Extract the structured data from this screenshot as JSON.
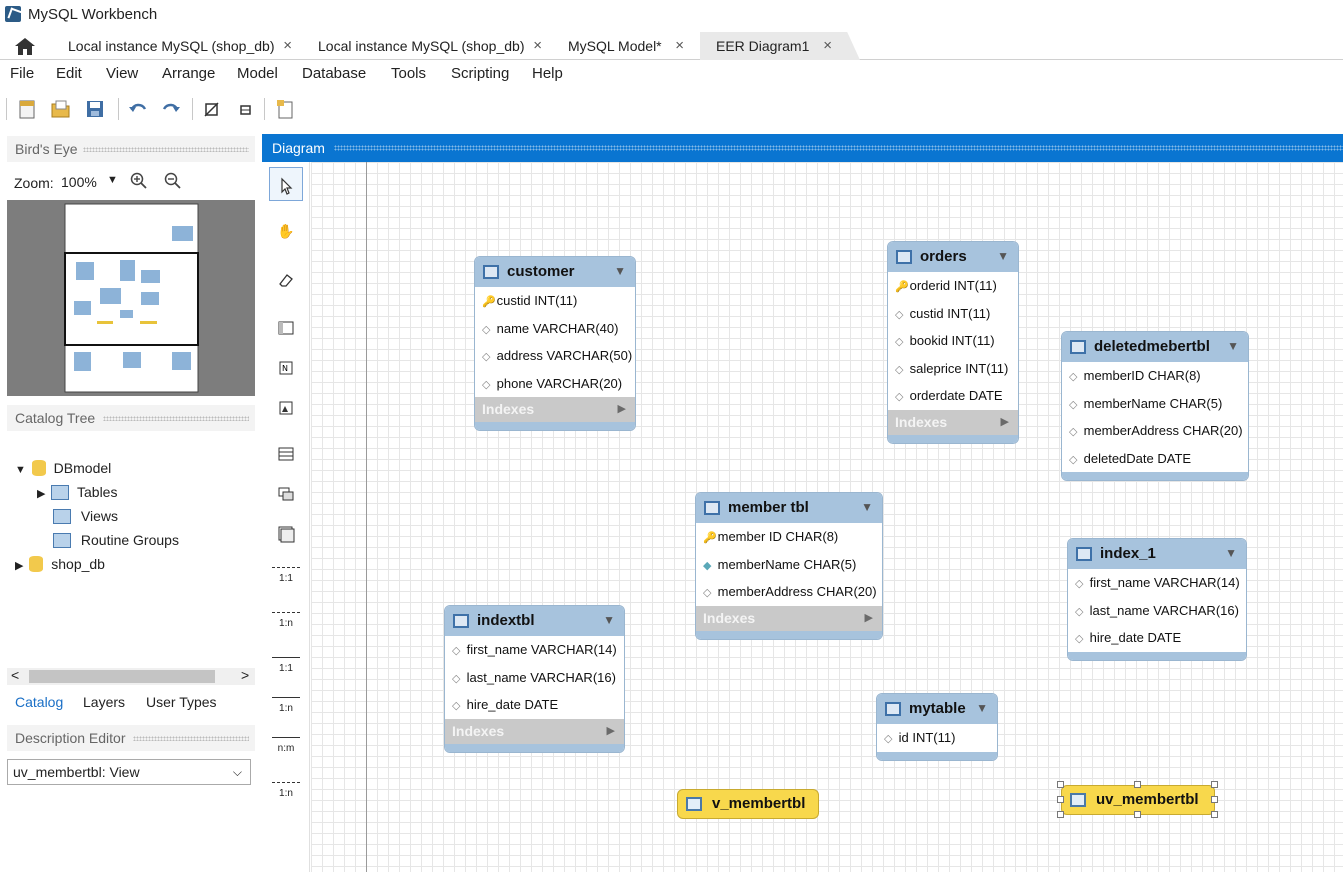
{
  "window": {
    "title": "MySQL Workbench"
  },
  "tabs": [
    {
      "label": "Local instance MySQL (shop_db)",
      "close": "×"
    },
    {
      "label": "Local instance MySQL (shop_db)",
      "close": "×"
    },
    {
      "label": "MySQL Model*",
      "close": "×"
    },
    {
      "label": "EER Diagram1",
      "close": "×"
    }
  ],
  "menu": [
    "File",
    "Edit",
    "View",
    "Arrange",
    "Model",
    "Database",
    "Tools",
    "Scripting",
    "Help"
  ],
  "left": {
    "birds_eye": "Bird's Eye",
    "zoom_label": "Zoom:",
    "zoom_value": "100%",
    "catalog_tree": "Catalog Tree",
    "tree": {
      "root": "DBmodel",
      "tables": "Tables",
      "views": "Views",
      "routine_groups": "Routine Groups",
      "schema": "shop_db"
    },
    "tabs": [
      "Catalog",
      "Layers",
      "User Types"
    ],
    "description_editor": "Description Editor",
    "description_select": "uv_membertbl: View"
  },
  "diagram": {
    "header": "Diagram",
    "relations": [
      "1:1",
      "1:n",
      "1:1",
      "1:n",
      "n:m",
      "1:n"
    ]
  },
  "indexes_label": "Indexes",
  "tables": {
    "customer": {
      "name": "customer",
      "cols": [
        "custid INT(11)",
        "name VARCHAR(40)",
        "address VARCHAR(50)",
        "phone VARCHAR(20)"
      ]
    },
    "orders": {
      "name": "orders",
      "cols": [
        "orderid INT(11)",
        "custid INT(11)",
        "bookid INT(11)",
        "saleprice INT(11)",
        "orderdate DATE"
      ]
    },
    "deletedmebertbl": {
      "name": "deletedmebertbl",
      "cols": [
        "memberID CHAR(8)",
        "memberName CHAR(5)",
        "memberAddress CHAR(20)",
        "deletedDate DATE"
      ]
    },
    "membertbl": {
      "name": "member tbl",
      "cols": [
        "member ID CHAR(8)",
        "memberName CHAR(5)",
        "memberAddress CHAR(20)"
      ]
    },
    "index1": {
      "name": "index_1",
      "cols": [
        "first_name VARCHAR(14)",
        "last_name VARCHAR(16)",
        "hire_date DATE"
      ]
    },
    "indextbl": {
      "name": "indextbl",
      "cols": [
        "first_name VARCHAR(14)",
        "last_name VARCHAR(16)",
        "hire_date DATE"
      ]
    },
    "mytable": {
      "name": "mytable",
      "cols": [
        "id INT(11)"
      ]
    }
  },
  "views": {
    "v": "v_membertbl",
    "uv": "uv_membertbl"
  }
}
